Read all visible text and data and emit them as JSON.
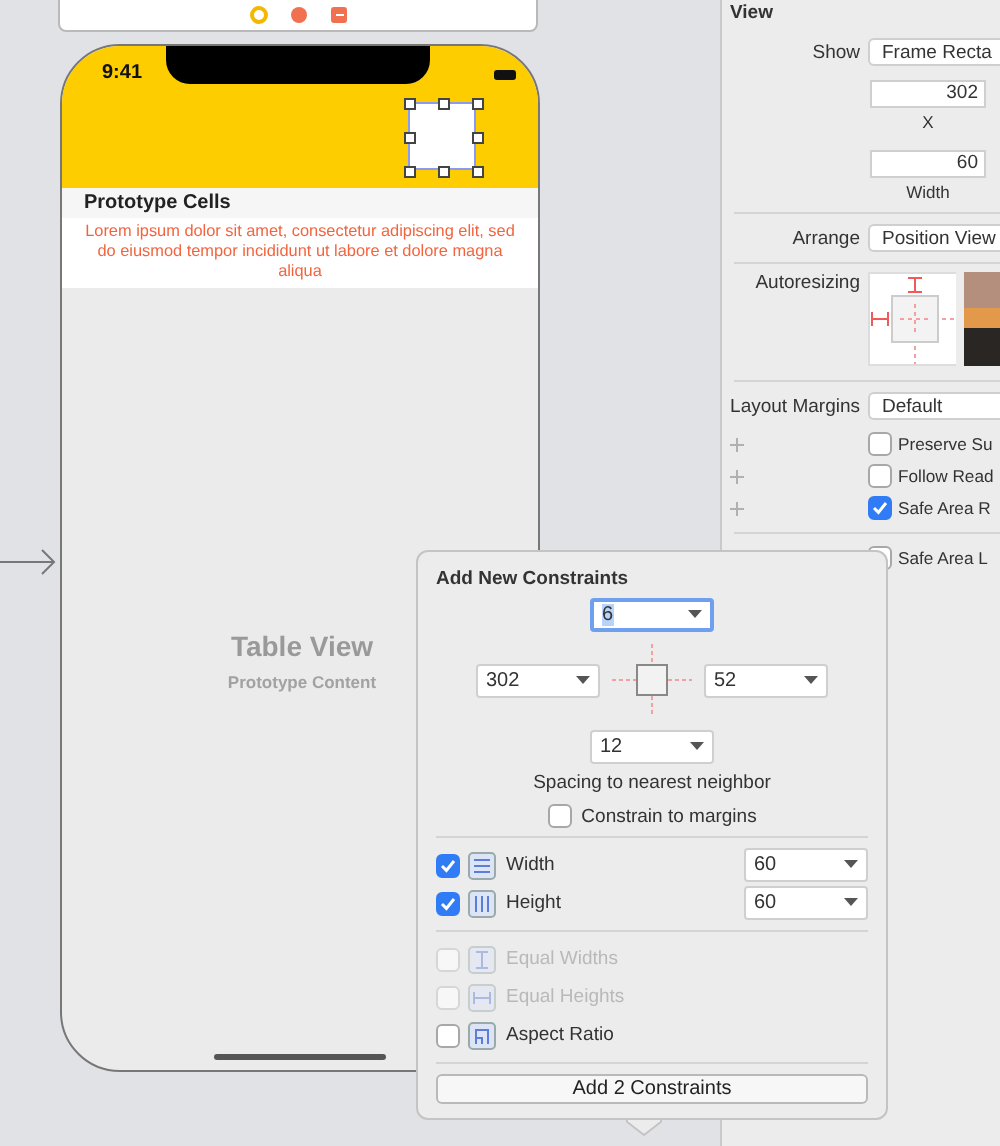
{
  "device": {
    "time": "9:41"
  },
  "table": {
    "header": "Prototype Cells",
    "cell_text": "Lorem ipsum dolor sit amet, consectetur adipiscing elit, sed do eiusmod tempor incididunt ut labore et dolore magna aliqua",
    "title": "Table View",
    "subtitle": "Prototype Content"
  },
  "inspector": {
    "section": "View",
    "show": {
      "label": "Show",
      "value": "Frame Recta"
    },
    "x": {
      "value": "302",
      "label": "X"
    },
    "width": {
      "value": "60",
      "label": "Width"
    },
    "arrange": {
      "label": "Arrange",
      "value": "Position View"
    },
    "autoresizing": {
      "label": "Autoresizing"
    },
    "layout_margins": {
      "label": "Layout Margins",
      "value": "Default"
    },
    "options": [
      {
        "label": "Preserve Su",
        "checked": false,
        "plus": true
      },
      {
        "label": "Follow Read",
        "checked": false,
        "plus": true
      },
      {
        "label": "Safe Area R",
        "checked": true,
        "plus": true
      },
      {
        "label": "Safe Area L",
        "checked": false,
        "plus": false
      }
    ]
  },
  "popover": {
    "title": "Add New Constraints",
    "top": {
      "value": "6",
      "selected": true
    },
    "left": {
      "value": "302",
      "selected": false
    },
    "right": {
      "value": "52",
      "selected": false
    },
    "bottom": {
      "value": "12",
      "selected": false
    },
    "spacing_label": "Spacing to nearest neighbor",
    "margins": {
      "label": "Constrain to margins",
      "checked": false
    },
    "size_rows": [
      {
        "kind": "width",
        "label": "Width",
        "checked": true,
        "value": "60"
      },
      {
        "kind": "height",
        "label": "Height",
        "checked": true,
        "value": "60"
      }
    ],
    "ratio_rows": [
      {
        "kind": "equal-widths",
        "label": "Equal Widths",
        "checked": false,
        "disabled": true
      },
      {
        "kind": "equal-heights",
        "label": "Equal Heights",
        "checked": false,
        "disabled": true
      },
      {
        "kind": "aspect",
        "label": "Aspect Ratio",
        "checked": false,
        "disabled": false
      }
    ],
    "button": "Add 2 Constraints"
  }
}
